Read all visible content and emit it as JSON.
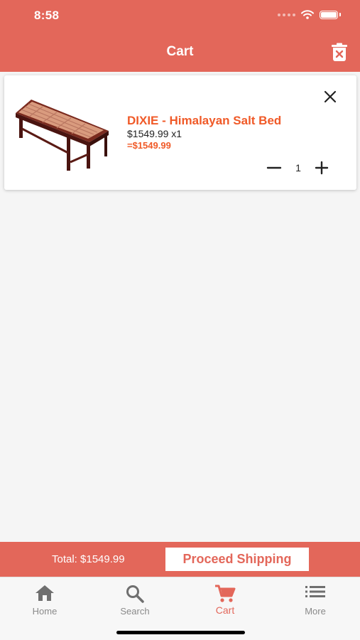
{
  "status_bar": {
    "time": "8:58"
  },
  "header": {
    "title": "Cart",
    "action_icon": "trash-icon"
  },
  "cart": {
    "items": [
      {
        "name": "DIXIE - Himalayan Salt Bed",
        "price_line": "$1549.99 x1",
        "subtotal": "=$1549.99",
        "quantity": "1",
        "image": "salt-bed-image"
      }
    ]
  },
  "checkout": {
    "total_label": "Total: $1549.99",
    "proceed_label": "Proceed Shipping"
  },
  "tabs": [
    {
      "label": "Home",
      "icon": "home-icon",
      "active": false
    },
    {
      "label": "Search",
      "icon": "search-icon",
      "active": false
    },
    {
      "label": "Cart",
      "icon": "cart-icon",
      "active": true
    },
    {
      "label": "More",
      "icon": "list-icon",
      "active": false
    }
  ],
  "colors": {
    "brand": "#e3675a",
    "accent_text": "#f05a28",
    "background": "#f5f5f5",
    "tab_inactive": "#8a8a8a"
  }
}
